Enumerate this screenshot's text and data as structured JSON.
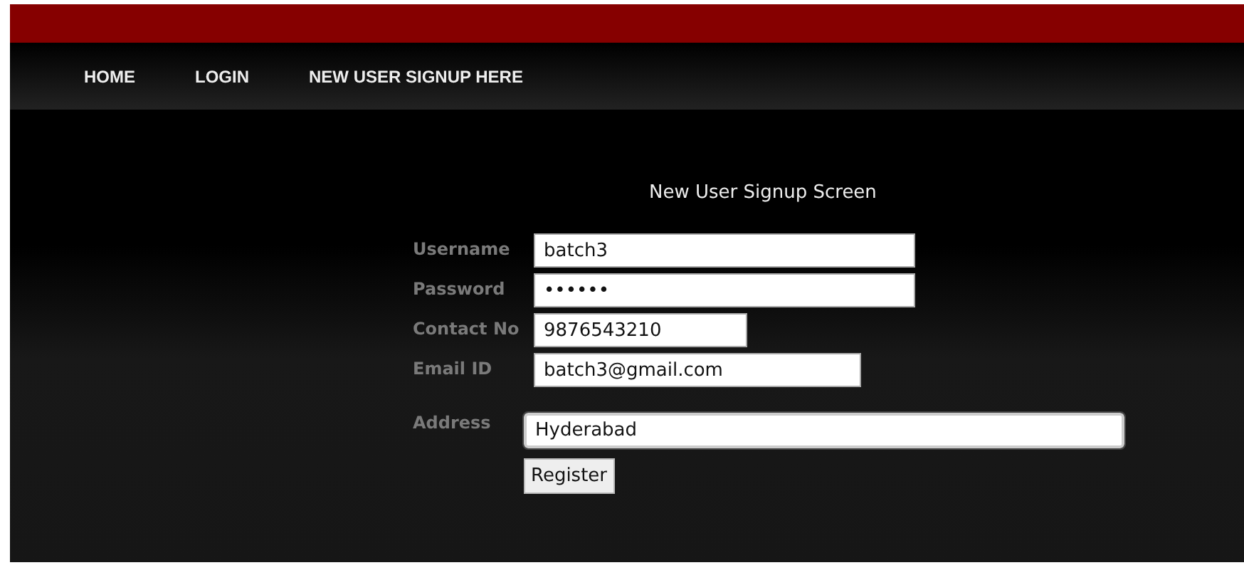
{
  "nav": {
    "items": [
      {
        "label": "HOME"
      },
      {
        "label": "LOGIN"
      },
      {
        "label": "NEW USER SIGNUP HERE"
      }
    ]
  },
  "form": {
    "title": "New User Signup Screen",
    "fields": [
      {
        "label": "Username",
        "value": "batch3",
        "kind": "long"
      },
      {
        "label": "Password",
        "value": "••••••",
        "kind": "long"
      },
      {
        "label": "Contact No",
        "value": "9876543210",
        "kind": "short"
      },
      {
        "label": "Email ID",
        "value": "batch3@gmail.com",
        "kind": "medium"
      },
      {
        "label": "Address",
        "value": "Hyderabad",
        "kind": "wide"
      }
    ],
    "button": "Register"
  }
}
